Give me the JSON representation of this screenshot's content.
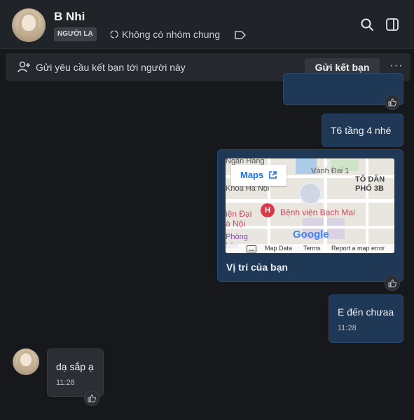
{
  "header": {
    "contact_name": "B Nhi",
    "stranger_badge": "NGƯỜI LẠ",
    "common_groups": "Không có nhóm chung"
  },
  "request_bar": {
    "text": "Gửi yêu cầu kết bạn tới người này",
    "button_label": "Gửi kết bạn",
    "more_label": "···"
  },
  "messages": [
    {
      "direction": "out",
      "text": "T6 tầng 4 nhé"
    },
    {
      "direction": "out",
      "type": "location",
      "caption": "Vị trí của bạn",
      "map": {
        "open_label": "Maps",
        "places": [
          "Ngân Hàng",
          "Khoa Hà Nội",
          "Vành Đai 1",
          "TỐ DÂN",
          "PHỐ 3B",
          "Bệnh viện Bạch Mai",
          "iện Đại",
          "à Nội",
          "Phòng",
          "hôn"
        ],
        "pin_letter": "H",
        "logo": "Google",
        "attribution": [
          "Map Data",
          "Terms",
          "Report a map error"
        ]
      }
    },
    {
      "direction": "out",
      "text": "E đến chưaa",
      "time": "11:28"
    },
    {
      "direction": "in",
      "text": "dạ sắp ạ",
      "time": "11:28"
    }
  ],
  "colors": {
    "background": "#16181b",
    "outgoing_bubble": "#1f3856",
    "incoming_bubble": "#2b2e33",
    "header": "#202327"
  },
  "icons": [
    "search-icon",
    "sidebar-toggle-icon",
    "group-icon",
    "tag-icon",
    "add-person-icon",
    "thumbs-up-icon",
    "external-link-icon",
    "keyboard-icon"
  ]
}
